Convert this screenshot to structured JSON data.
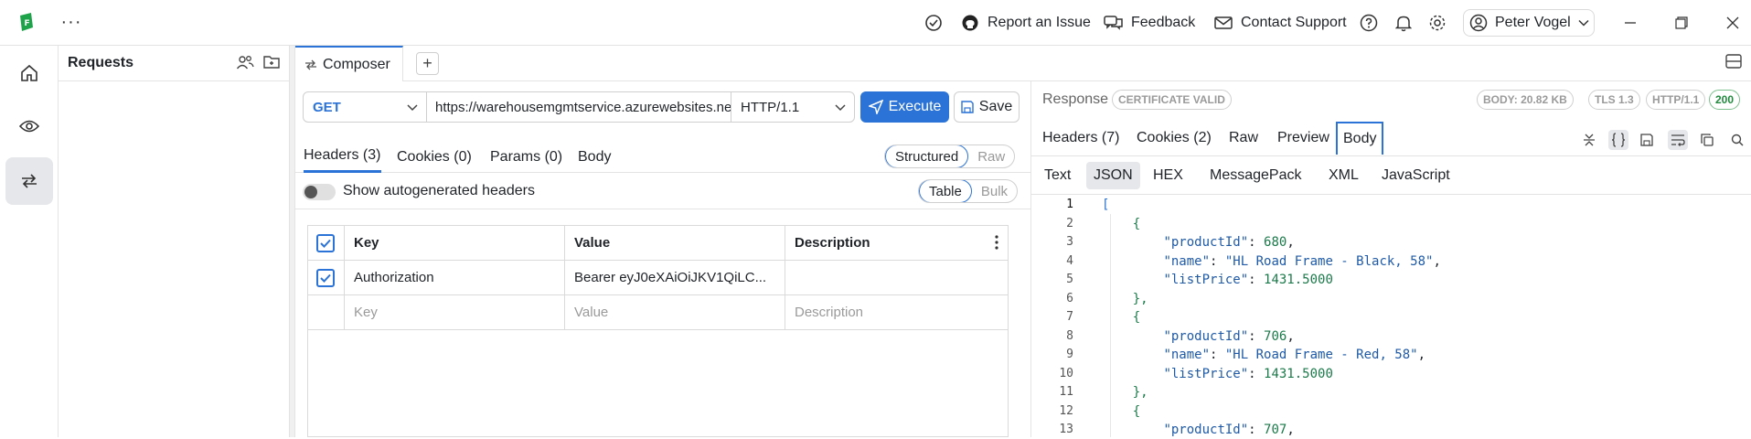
{
  "topbar": {
    "logo_letter": "F",
    "more_label": "···",
    "report_issue": "Report an Issue",
    "feedback": "Feedback",
    "contact_support": "Contact Support",
    "user_name": "Peter Vogel"
  },
  "requests_panel": {
    "title": "Requests"
  },
  "tabs": {
    "composer": "Composer",
    "add": "+"
  },
  "composer": {
    "method": "GET",
    "url": "https://warehousemgmtservice.azurewebsites.net",
    "http_version": "HTTP/1.1",
    "execute": "Execute",
    "save": "Save",
    "tabs": [
      "Headers (3)",
      "Cookies (0)",
      "Params (0)",
      "Body"
    ],
    "mode_structured": "Structured",
    "mode_raw": "Raw",
    "autogen_label": "Show autogenerated headers",
    "view_table": "Table",
    "view_bulk": "Bulk",
    "table": {
      "columns": [
        "Key",
        "Value",
        "Description"
      ],
      "rows": [
        {
          "checked": true,
          "key": "Authorization",
          "value": "Bearer eyJ0eXAiOiJKV1QiLC...",
          "description": ""
        }
      ],
      "placeholders": {
        "key": "Key",
        "value": "Value",
        "description": "Description"
      }
    }
  },
  "response": {
    "title": "Response",
    "certificate": "CERTIFICATE VALID",
    "body_size": "BODY: 20.82 KB",
    "tls": "TLS 1.3",
    "http": "HTTP/1.1",
    "status": "200",
    "tabs": [
      "Headers (7)",
      "Cookies (2)",
      "Raw",
      "Preview",
      "Body"
    ],
    "active_tab": "Body",
    "formats": [
      "Text",
      "JSON",
      "HEX",
      "MessagePack",
      "XML",
      "JavaScript"
    ],
    "active_format": "JSON",
    "code_lines": [
      {
        "n": "1",
        "t": "["
      },
      {
        "n": "2",
        "t": "    {"
      },
      {
        "n": "3",
        "t": "        \"productId\": 680,"
      },
      {
        "n": "4",
        "t": "        \"name\": \"HL Road Frame - Black, 58\","
      },
      {
        "n": "5",
        "t": "        \"listPrice\": 1431.5000"
      },
      {
        "n": "6",
        "t": "    },"
      },
      {
        "n": "7",
        "t": "    {"
      },
      {
        "n": "8",
        "t": "        \"productId\": 706,"
      },
      {
        "n": "9",
        "t": "        \"name\": \"HL Road Frame - Red, 58\","
      },
      {
        "n": "10",
        "t": "        \"listPrice\": 1431.5000"
      },
      {
        "n": "11",
        "t": "    },"
      },
      {
        "n": "12",
        "t": "    {"
      },
      {
        "n": "13",
        "t": "        \"productId\": 707,"
      }
    ]
  },
  "colors": {
    "accent": "#2b73d6",
    "status_ok": "#1f8a3c",
    "logo": "#1fa34a"
  }
}
